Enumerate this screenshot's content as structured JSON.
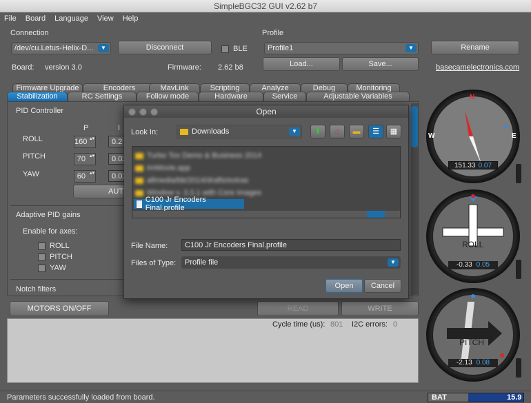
{
  "window": {
    "title": "SimpleBGC32 GUI v2.62 b7"
  },
  "menu": [
    "File",
    "Board",
    "Language",
    "View",
    "Help"
  ],
  "connection": {
    "label": "Connection",
    "port": "/dev/cu.Letus-Helix-D...",
    "disconnect": "Disconnect",
    "ble_label": "BLE",
    "ble_checked": false,
    "board_label": "Board:",
    "board_value": "version 3.0",
    "firmware_label": "Firmware:",
    "firmware_value": "2.62 b8"
  },
  "profile": {
    "label": "Profile",
    "selected": "Profile1",
    "rename": "Rename",
    "load": "Load...",
    "save": "Save...",
    "link": "basecamelectronics.com"
  },
  "tabs_row1": [
    "Firmware Upgrade",
    "Encoders",
    "MavLink",
    "Scripting",
    "Analyze",
    "Debug",
    "Monitoring"
  ],
  "tabs_row2": [
    "Stabilization",
    "RC Settings",
    "Follow mode",
    "Hardware",
    "Service",
    "Adjustable Variables"
  ],
  "active_tab": "Stabilization",
  "pid": {
    "title": "PID Controller",
    "col_p": "P",
    "col_i": "I",
    "rows": [
      {
        "axis": "ROLL",
        "p": "160",
        "i": "0.2"
      },
      {
        "axis": "PITCH",
        "p": "70",
        "i": "0.02"
      },
      {
        "axis": "YAW",
        "p": "60",
        "i": "0.02"
      }
    ],
    "auto_button": "AUT"
  },
  "adaptive": {
    "title": "Adaptive PID gains",
    "enable_label": "Enable for axes:",
    "axes": [
      {
        "label": "ROLL",
        "checked": false
      },
      {
        "label": "PITCH",
        "checked": false
      },
      {
        "label": "YAW",
        "checked": false
      }
    ]
  },
  "notch": {
    "title": "Notch filters"
  },
  "bottom": {
    "motors": "MOTORS ON/OFF",
    "read": "READ",
    "write": "WRITE",
    "cycle_label": "Cycle time (us):",
    "cycle_value": "801",
    "i2c_label": "I2C errors:",
    "i2c_value": "0"
  },
  "status": {
    "message": "Parameters successfully loaded from board.",
    "bat_label": "BAT",
    "bat_value": "15.9"
  },
  "dialog": {
    "title": "Open",
    "look_in_label": "Look In:",
    "look_in_value": "Downloads",
    "files": [
      {
        "name": "Turbo Tox Demo & Business 2014",
        "blurred": true,
        "type": "folder"
      },
      {
        "name": "ImMovie.app",
        "blurred": true,
        "type": "folder"
      },
      {
        "name": "allmedia/bb/2014/drafts/extras",
        "blurred": true,
        "type": "folder"
      },
      {
        "name": "Window v. 3.3.1 with Core Images",
        "blurred": true,
        "type": "folder"
      },
      {
        "name": "C100 Jr Encoders Final.profile",
        "blurred": false,
        "type": "file",
        "selected": true
      }
    ],
    "file_name_label": "File Name:",
    "file_name_value": "C100 Jr Encoders Final.profile",
    "file_type_label": "Files of Type:",
    "file_type_value": "Profile file",
    "open": "Open",
    "cancel": "Cancel"
  },
  "gauges": {
    "yaw": {
      "angle": "151.33",
      "rate": "0.07",
      "labels": [
        "N",
        "W",
        "E"
      ]
    },
    "roll": {
      "label": "ROLL",
      "angle": "-0.33",
      "rate": "0.05"
    },
    "pitch": {
      "label": "PITCH",
      "angle": "-2.13",
      "rate": "0.08"
    }
  }
}
